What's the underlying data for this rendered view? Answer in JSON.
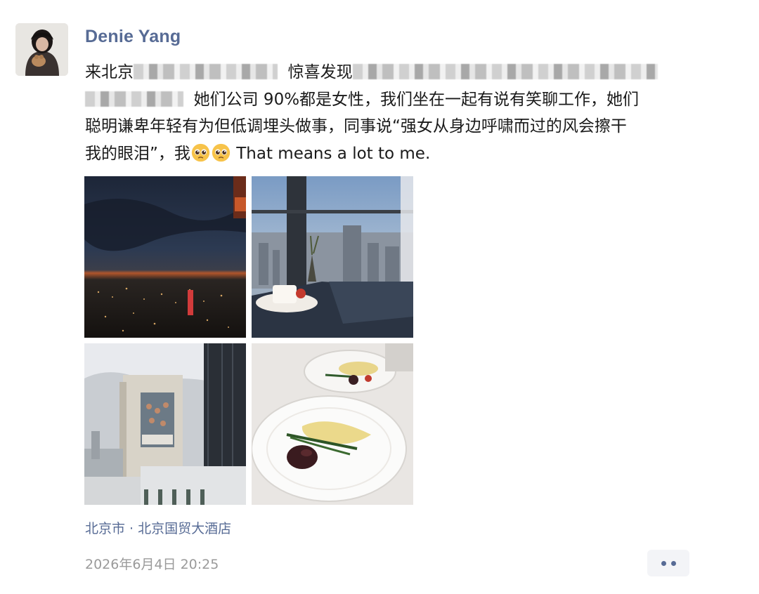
{
  "post": {
    "author": "Denie Yang",
    "text_line1_a": "来北京",
    "text_line1_b": "惊喜发现",
    "text_line2": "她们公司 90%都是女性，我们坐在一起有说有笑聊工作，她们",
    "text_line3": "聪明谦卑年轻有为但低调埋头做事，同事说“强女从身边呼啸而过的风会擦干",
    "text_line4_a": "我的眼泪”，我",
    "text_line4_b": "That means a lot to me.",
    "emoji": "pleading-face",
    "location": "北京市 · 北京国贸大酒店",
    "timestamp": "2026年6月4日 20:25"
  },
  "images": [
    {
      "name": "night-city-skyline-photo"
    },
    {
      "name": "window-view-with-coffee-photo"
    },
    {
      "name": "building-billboard-photo"
    },
    {
      "name": "breakfast-plate-photo"
    }
  ],
  "colors": {
    "link": "#576b95",
    "text": "#1a1a1a",
    "muted": "#9a9a9a",
    "button_bg": "#f3f4f7"
  }
}
